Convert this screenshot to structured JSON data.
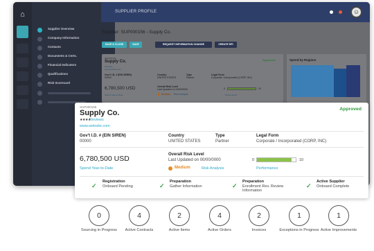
{
  "background": {
    "header_title": "SUPPLIER PROFILE",
    "supplier_line": "Supplier: SUP000156 - Supply Co.",
    "buttons": [
      "SAVE & CLOSE",
      "SAVE",
      "REQUEST INFORMATION CHANGE",
      "CREATE RFI"
    ],
    "sidebar": [
      "Supplier Overview",
      "Company Information",
      "Contacts",
      "Documents & Certs.",
      "Financial Indicators",
      "Qualifications",
      "Risk Scorecard"
    ],
    "mini_card": {
      "id": "SUP000156",
      "name": "Supply Co.",
      "approved": "Approved",
      "reviews": "Reviews",
      "website": "www.website.com",
      "gov_label": "Gov't I.D. # (EIN SIREN)",
      "gov_value": "00000",
      "country_label": "Country",
      "country_value": "UNITED STATES",
      "type_label": "Type",
      "type_value": "Partner",
      "legal_label": "Legal Form",
      "legal_value": "Corporate / Incorporated (CORP, INC)",
      "amount": "6,780,500 USD",
      "spend": "Spend Year-to-Date",
      "risk_label": "Overall Risk Level",
      "risk_updated": "Last Updated on 00/00/0000",
      "medium": "Medium",
      "risk_analysis": "Risk Analysis",
      "perf_min": "0",
      "perf_max": "10",
      "performance": "Performance"
    },
    "regions_title": "Spend by Regions"
  },
  "card": {
    "id": "SUP000156",
    "name": "Supply Co.",
    "status": "Approved",
    "stars": "★★★★",
    "reviews": "Reviews",
    "website": "www.website.com",
    "gov_label": "Gov't I.D. # (EIN SIREN)",
    "gov_value": "00000",
    "country_label": "Country",
    "country_value": "UNITED STATES",
    "type_label": "Type",
    "type_value": "Partner",
    "legal_label": "Legal Form",
    "legal_value": "Corporate / Incorporated (CORP, INC)",
    "amount": "6,780,500 USD",
    "spend_link": "Spend Year-to-Date",
    "risk_label": "Overall Risk Level",
    "risk_updated": "Last Updated on 00/00/0000",
    "risk_level": "Medium",
    "risk_analysis": "Risk Analysis",
    "perf_min": "0",
    "perf_max": "10",
    "perf_fraction": 0.9,
    "performance_link": "Performance",
    "steps": [
      {
        "title": "Registration",
        "sub": "Onboard Pending"
      },
      {
        "title": "Preparation",
        "sub": "Gather Information"
      },
      {
        "title": "Preparation",
        "sub": "Enrollment Rev. Review Information"
      },
      {
        "title": "Active Supplier",
        "sub": "Onboard Complete"
      }
    ]
  },
  "metrics": [
    {
      "value": "0",
      "label": "Sourcing in Progress"
    },
    {
      "value": "4",
      "label": "Active Contracts"
    },
    {
      "value": "2",
      "label": "Active Items"
    },
    {
      "value": "4",
      "label": "Active Orders"
    },
    {
      "value": "2",
      "label": "Invoices"
    },
    {
      "value": "1",
      "label": "Exceptions in Progress"
    },
    {
      "value": "1",
      "label": "Active Improvements"
    }
  ],
  "colors": {
    "accent": "#2aa6c6",
    "approved": "#2f9a3a",
    "medium": "#e58b28",
    "performance": "#8bc34a",
    "header": "#2d3e68"
  }
}
